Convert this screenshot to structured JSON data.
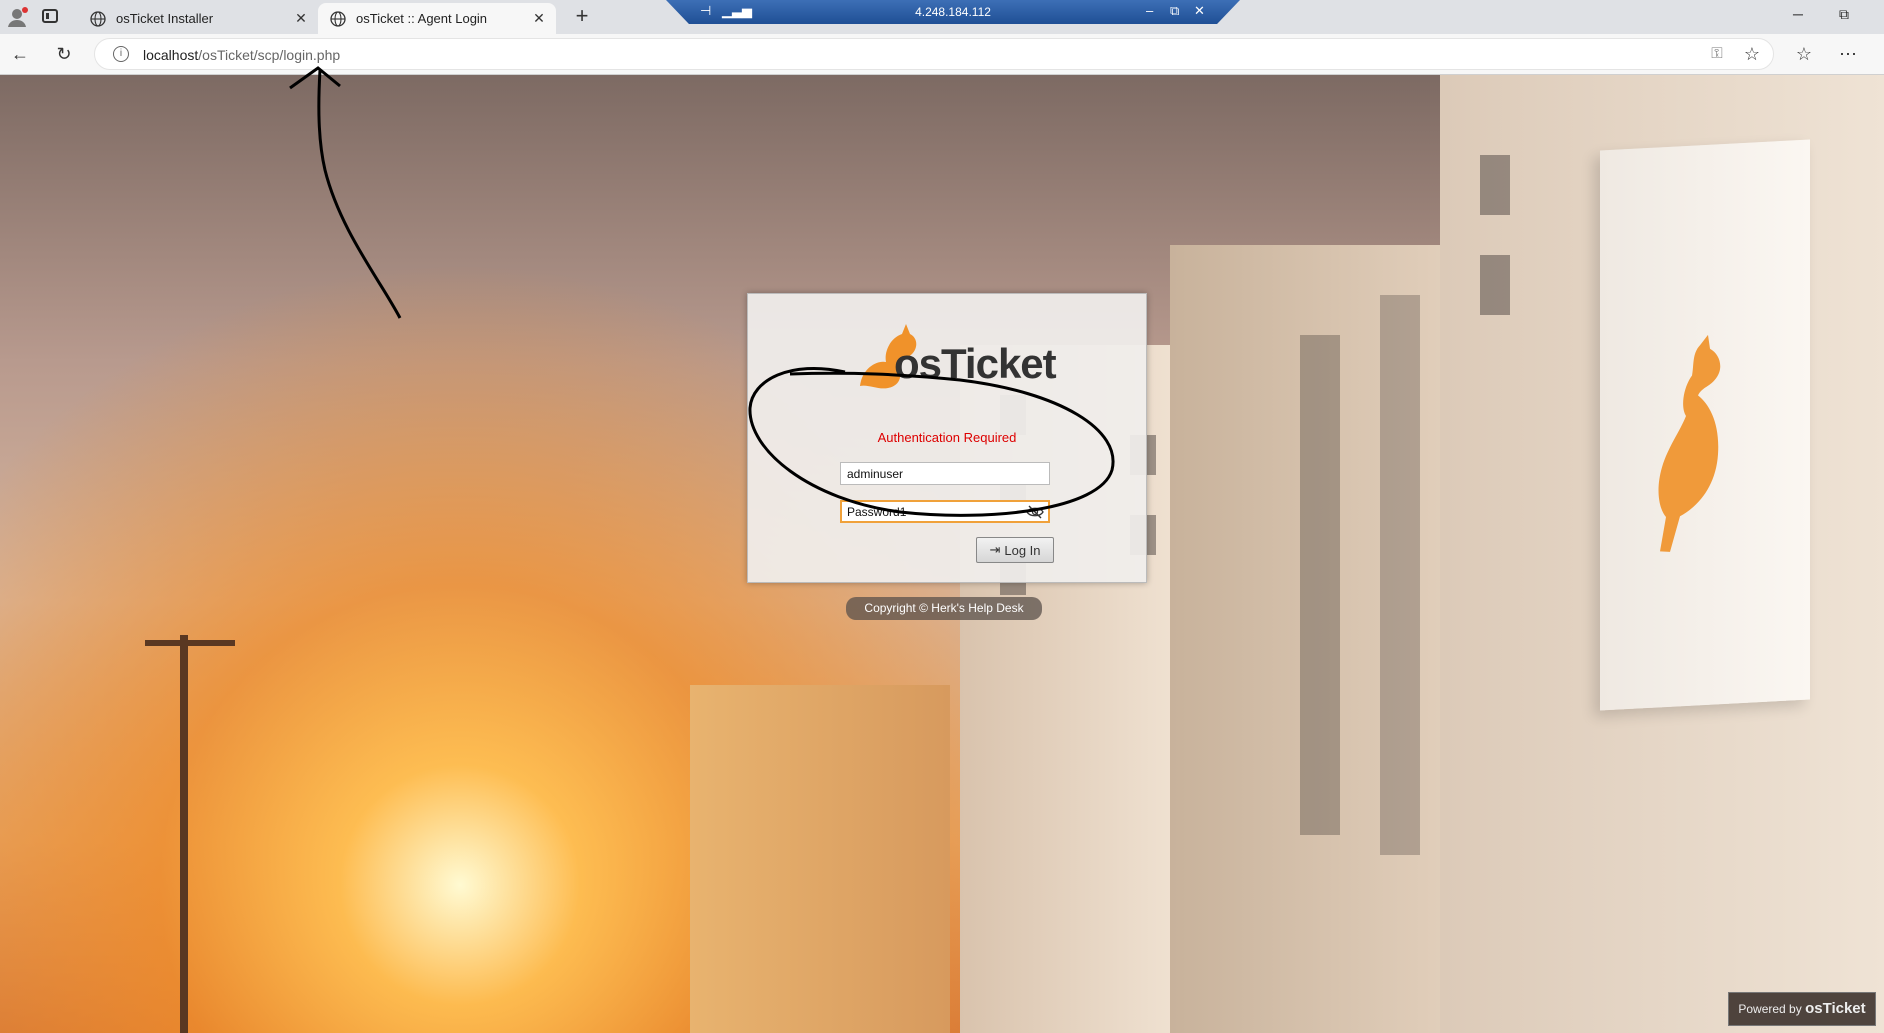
{
  "browser": {
    "tabs": [
      {
        "title": "osTicket Installer",
        "active": false
      },
      {
        "title": "osTicket :: Agent Login",
        "active": true
      }
    ],
    "url_host": "localhost",
    "url_path": "/osTicket/scp/login.php",
    "remote_ip": "4.248.184.112"
  },
  "login": {
    "logo_text": "osTicket",
    "auth_message": "Authentication Required",
    "username_value": "adminuser",
    "password_value": "Password1",
    "login_button_label": "Log In"
  },
  "footer": {
    "copyright": "Copyright © Herk's Help Desk",
    "powered_by": "Powered by",
    "powered_brand": "osTicket"
  },
  "colors": {
    "accent_orange": "#f0a13a",
    "auth_red": "#dd0000"
  },
  "icons": [
    "profile-icon",
    "tab-actions-icon",
    "globe-icon",
    "close-icon",
    "new-tab-icon",
    "back-icon",
    "refresh-icon",
    "info-icon",
    "key-icon",
    "star-icon",
    "favorites-icon",
    "more-icon",
    "eye-slash-icon",
    "login-icon",
    "kangaroo-logo"
  ]
}
